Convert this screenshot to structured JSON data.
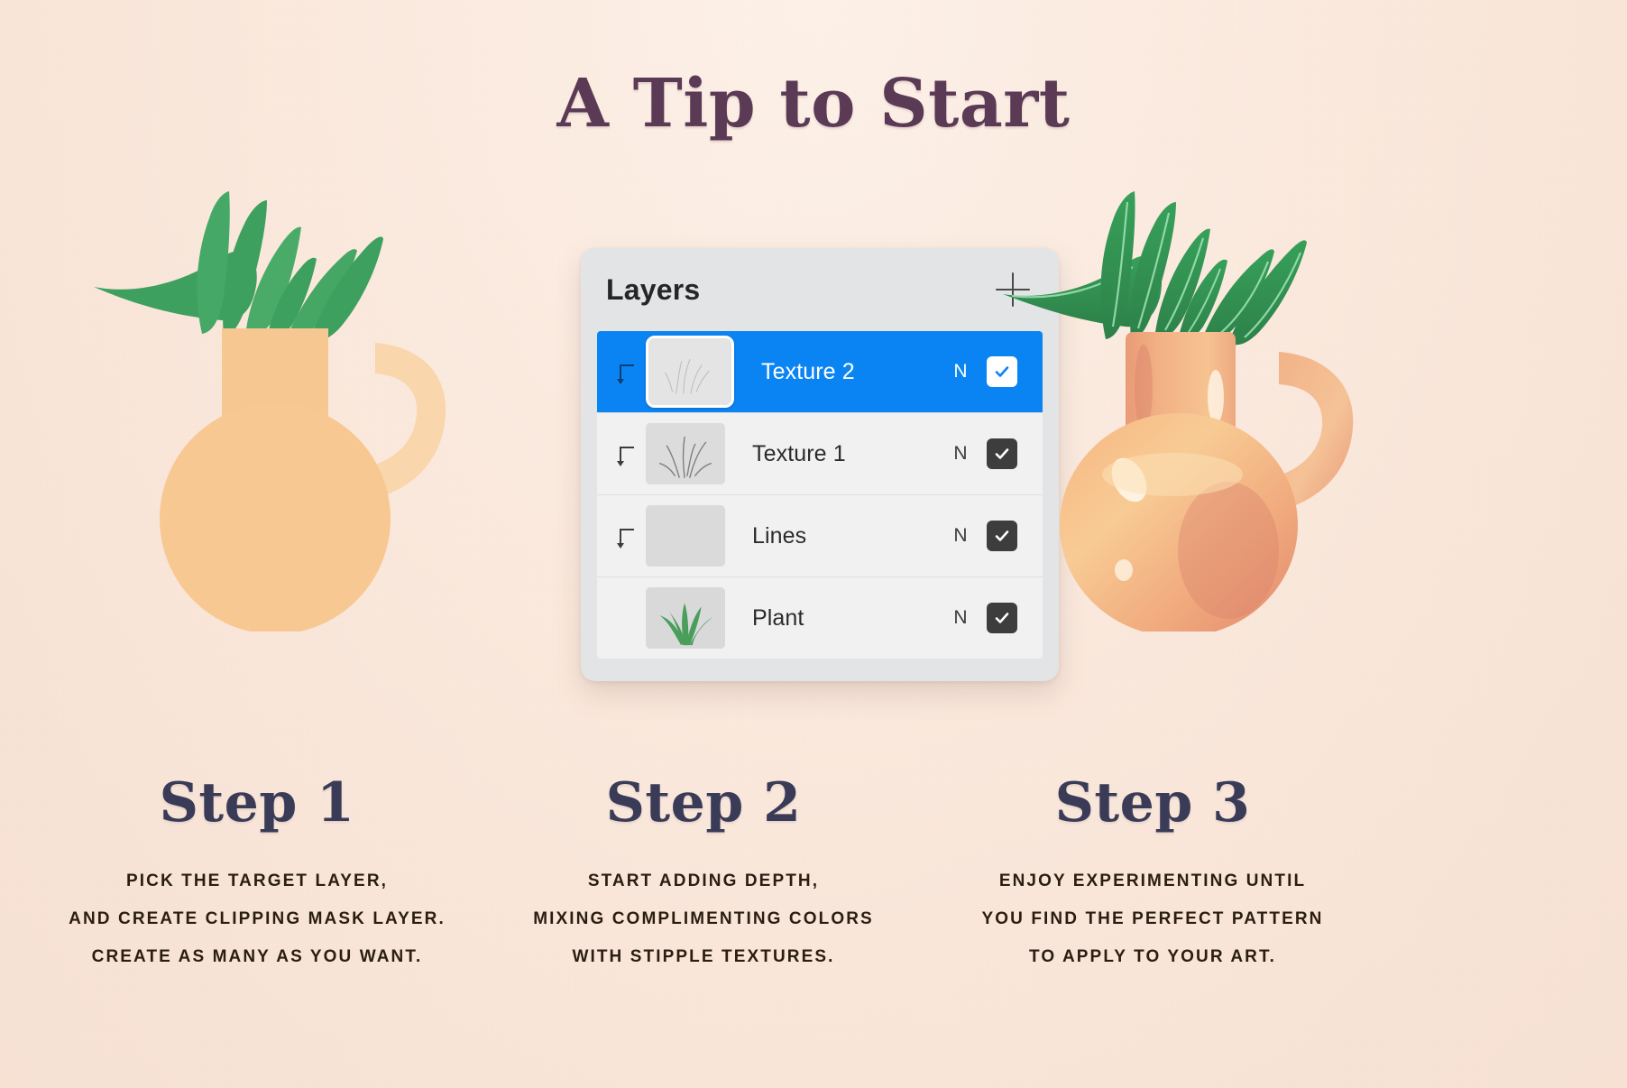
{
  "page": {
    "title": "A Tip to Start",
    "background_color": "#fbeadf"
  },
  "layers_panel": {
    "header_title": "Layers",
    "add_icon": "plus-icon",
    "accent_color": "#0b84f3",
    "layers": [
      {
        "name": "Texture 2",
        "blend_mode": "N",
        "visible": true,
        "selected": true,
        "clipping_mask": true,
        "thumbnail": "faint-stipple-sketch"
      },
      {
        "name": "Texture 1",
        "blend_mode": "N",
        "visible": true,
        "selected": false,
        "clipping_mask": true,
        "thumbnail": "grass-sketch-strokes"
      },
      {
        "name": "Lines",
        "blend_mode": "N",
        "visible": true,
        "selected": false,
        "clipping_mask": true,
        "thumbnail": "empty-gray"
      },
      {
        "name": "Plant",
        "blend_mode": "N",
        "visible": true,
        "selected": false,
        "clipping_mask": false,
        "thumbnail": "green-plant"
      }
    ]
  },
  "steps": [
    {
      "title": "Step 1",
      "lines": [
        "PICK THE TARGET LAYER,",
        "AND CREATE CLIPPING MASK LAYER.",
        "CREATE AS MANY AS YOU WANT."
      ],
      "illustration": "flat-peach-vase-with-green-plant"
    },
    {
      "title": "Step 2",
      "lines": [
        "START ADDING DEPTH,",
        "MIXING COMPLIMENTING COLORS",
        "WITH STIPPLE TEXTURES."
      ],
      "illustration": "layers-panel"
    },
    {
      "title": "Step 3",
      "lines": [
        "ENJOY EXPERIMENTING UNTIL",
        "YOU FIND THE PERFECT PATTERN",
        "TO APPLY TO YOUR ART."
      ],
      "illustration": "shaded-textured-peach-vase-with-green-plant"
    }
  ],
  "colors": {
    "title_purple": "#5a3a55",
    "step_navy": "#3a3b57",
    "caption_brown": "#2b1d12",
    "vase_peach": "#f6c08b",
    "vase_handle": "#f8d3a8",
    "leaf_green": "#3da05e",
    "selected_blue": "#0b84f3",
    "panel_gray": "#e2e4e6"
  }
}
